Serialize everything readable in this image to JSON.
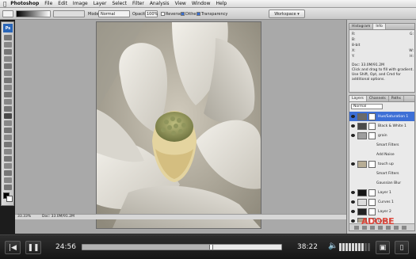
{
  "menubar": {
    "apple_icon": "apple-icon",
    "items": [
      "Photoshop",
      "File",
      "Edit",
      "Image",
      "Layer",
      "Select",
      "Filter",
      "Analysis",
      "View",
      "Window",
      "Help"
    ]
  },
  "options": {
    "mode_label": "Mode:",
    "mode_value": "Normal",
    "opacity_label": "Opacity:",
    "opacity_value": "100%",
    "reverse_label": "Reverse",
    "dither_label": "Dither",
    "transparency_label": "Transparency",
    "workspace_label": "Workspace ▾"
  },
  "statusbar": {
    "zoom": "33.33%",
    "doc": "Doc: 33.0M/91.2M"
  },
  "panels": {
    "top_tabs": [
      "Histogram",
      "Info"
    ],
    "info_rows": [
      {
        "k": "R:",
        "v": "G:"
      },
      {
        "k": "B:",
        "v": ""
      },
      {
        "k": "8-bit",
        "v": ""
      },
      {
        "k": "X:",
        "v": "W:"
      },
      {
        "k": "Y:",
        "v": "H:"
      }
    ],
    "info_doc": "Doc: 33.0M/91.2M",
    "info_hint": "Click and drag to fill with gradient. Use Shift, Opt, and Cmd for additional options.",
    "layer_tabs": [
      "Layers",
      "Channels",
      "Paths"
    ],
    "blend_mode": "Normal",
    "layers": [
      {
        "name": "Hue/Saturation 1",
        "selected": true,
        "thumb": "#6a6a6a"
      },
      {
        "name": "Black & White 1",
        "selected": false,
        "thumb": "#4a4a4a"
      },
      {
        "name": "grain",
        "selected": false,
        "thumb": "#9e9e9e"
      },
      {
        "name": "Smart Filters",
        "selected": false,
        "sub": true
      },
      {
        "name": "Add Noise",
        "selected": false,
        "sub": true
      },
      {
        "name": "touch up",
        "selected": false,
        "thumb": "#b7ad95"
      },
      {
        "name": "Smart Filters",
        "selected": false,
        "sub": true
      },
      {
        "name": "Gaussian Blur",
        "selected": false,
        "sub": true
      },
      {
        "name": "Layer 1",
        "selected": false,
        "thumb": "#151515"
      },
      {
        "name": "Curves 1",
        "selected": false,
        "thumb": "#dddddd"
      },
      {
        "name": "Layer 2",
        "selected": false,
        "thumb": "#222222"
      },
      {
        "name": "Layer 0",
        "selected": false,
        "thumb": "#aca38e"
      }
    ]
  },
  "watermark": "ADOBE",
  "player": {
    "elapsed": "24:56",
    "total": "38:22",
    "progress": 0.65,
    "volume": 0.78,
    "prev_icon": "skip-back-icon",
    "pause_icon": "pause-icon",
    "volume_icon": "speaker-icon",
    "fullscreen_icon": "fullscreen-icon",
    "captions_icon": "captions-icon"
  }
}
